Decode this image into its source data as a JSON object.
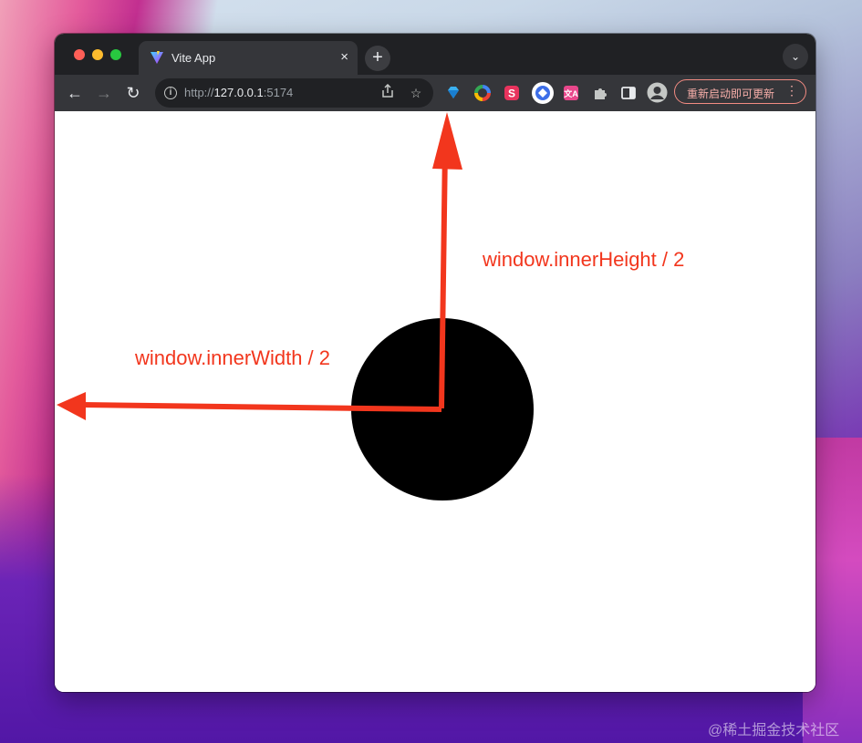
{
  "tab": {
    "title": "Vite App",
    "close": "×"
  },
  "new_tab": "+",
  "tab_search": "⌄",
  "nav": {
    "back": "←",
    "forward": "→",
    "reload": "↻"
  },
  "address": {
    "scheme": "http://",
    "host": "127.0.0.1",
    "port": ":5174"
  },
  "update_button": {
    "label": "重新启动即可更新",
    "more": "⋮"
  },
  "annotations": {
    "height_label": "window.innerHeight / 2",
    "width_label": "window.innerWidth / 2"
  },
  "watermark": "@稀土掘金技术社区",
  "colors": {
    "annotation": "#f2361d",
    "circle": "#000000"
  }
}
